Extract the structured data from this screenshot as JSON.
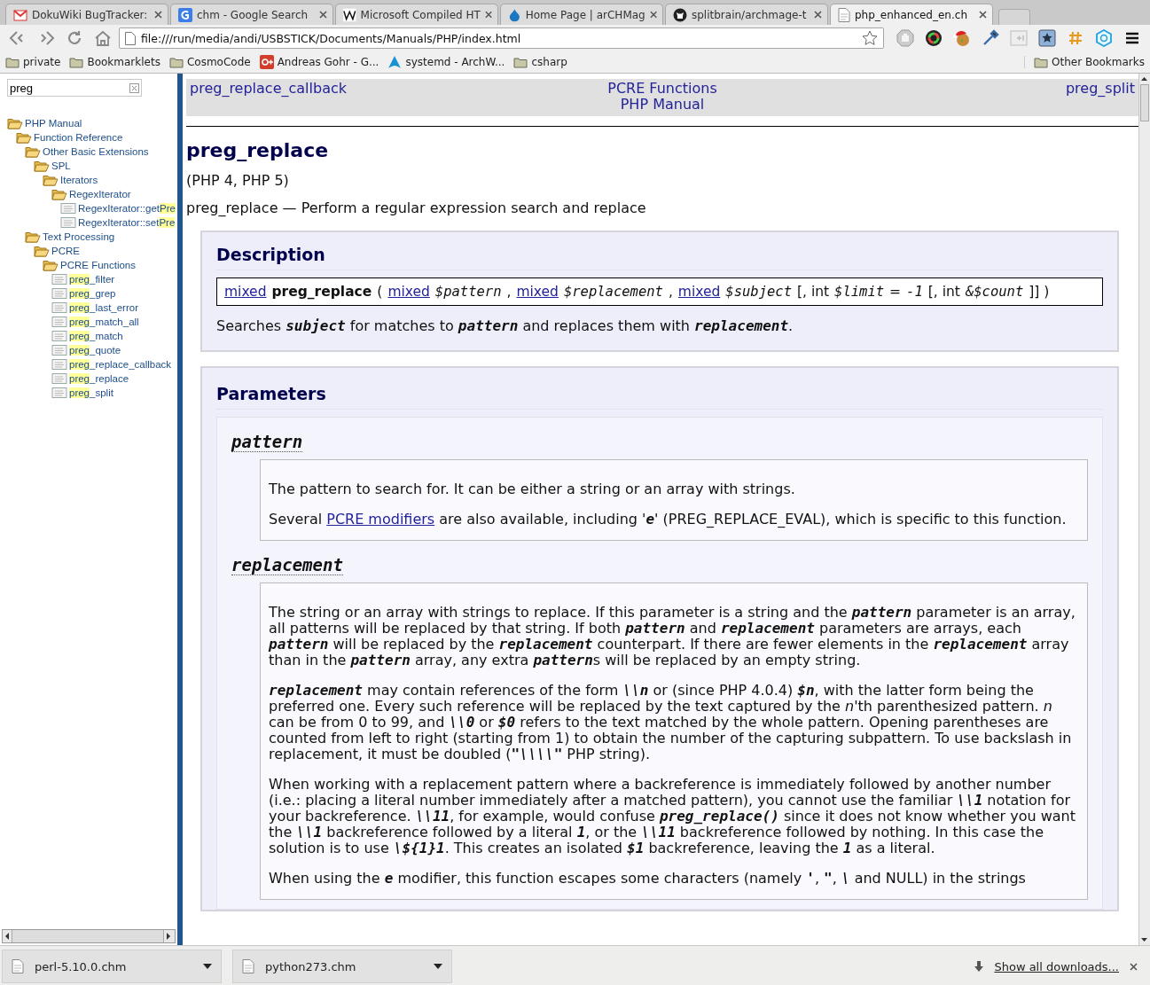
{
  "tabs": [
    {
      "title": "DokuWiki BugTracker:",
      "selected": false
    },
    {
      "title": "chm - Google Search",
      "selected": false
    },
    {
      "title": "Microsoft Compiled HT",
      "selected": false
    },
    {
      "title": "Home Page | arCHMag",
      "selected": false
    },
    {
      "title": "splitbrain/archmage-t",
      "selected": false
    },
    {
      "title": "php_enhanced_en.ch",
      "selected": true
    }
  ],
  "address_bar": {
    "value": "file:///run/media/andi/USBSTICK/Documents/Manuals/PHP/index.html"
  },
  "bookmarks": [
    {
      "label": "private",
      "kind": "folder"
    },
    {
      "label": "Bookmarklets",
      "kind": "folder"
    },
    {
      "label": "CosmoCode",
      "kind": "folder"
    },
    {
      "label": "Andreas Gohr - G...",
      "kind": "site"
    },
    {
      "label": "systemd - ArchW...",
      "kind": "site"
    },
    {
      "label": "csharp",
      "kind": "folder"
    }
  ],
  "other_bookmarks": "Other Bookmarks",
  "sidebar": {
    "search": {
      "value": "preg"
    },
    "tree": [
      {
        "kind": "folder",
        "parts": [
          {
            "text": "PHP Manual",
            "match": false
          }
        ],
        "children": [
          {
            "kind": "folder",
            "parts": [
              {
                "text": "Function Reference",
                "match": false
              }
            ],
            "children": [
              {
                "kind": "folder",
                "parts": [
                  {
                    "text": "Other Basic Extensions",
                    "match": false
                  }
                ],
                "children": [
                  {
                    "kind": "folder",
                    "parts": [
                      {
                        "text": "SPL",
                        "match": false
                      }
                    ],
                    "children": [
                      {
                        "kind": "folder",
                        "parts": [
                          {
                            "text": "Iterators",
                            "match": false
                          }
                        ],
                        "children": [
                          {
                            "kind": "folder",
                            "parts": [
                              {
                                "text": "RegexIterator",
                                "match": false
                              }
                            ],
                            "children": [
                              {
                                "kind": "page",
                                "parts": [
                                  {
                                    "text": "RegexIterator::get",
                                    "match": false
                                  },
                                  {
                                    "text": "Pre",
                                    "match": true
                                  }
                                ]
                              },
                              {
                                "kind": "page",
                                "parts": [
                                  {
                                    "text": "RegexIterator::set",
                                    "match": false
                                  },
                                  {
                                    "text": "Pre",
                                    "match": true
                                  }
                                ]
                              }
                            ]
                          }
                        ]
                      }
                    ]
                  }
                ]
              },
              {
                "kind": "folder",
                "parts": [
                  {
                    "text": "Text Processing",
                    "match": false
                  }
                ],
                "children": [
                  {
                    "kind": "folder",
                    "parts": [
                      {
                        "text": "PCRE",
                        "match": false
                      }
                    ],
                    "children": [
                      {
                        "kind": "folder",
                        "parts": [
                          {
                            "text": "PCRE Functions",
                            "match": false
                          }
                        ],
                        "children": [
                          {
                            "kind": "page",
                            "parts": [
                              {
                                "text": "preg",
                                "match": true
                              },
                              {
                                "text": "_filter",
                                "match": false
                              }
                            ]
                          },
                          {
                            "kind": "page",
                            "parts": [
                              {
                                "text": "preg",
                                "match": true
                              },
                              {
                                "text": "_grep",
                                "match": false
                              }
                            ]
                          },
                          {
                            "kind": "page",
                            "parts": [
                              {
                                "text": "preg",
                                "match": true
                              },
                              {
                                "text": "_last_error",
                                "match": false
                              }
                            ]
                          },
                          {
                            "kind": "page",
                            "parts": [
                              {
                                "text": "preg",
                                "match": true
                              },
                              {
                                "text": "_match_all",
                                "match": false
                              }
                            ]
                          },
                          {
                            "kind": "page",
                            "parts": [
                              {
                                "text": "preg",
                                "match": true
                              },
                              {
                                "text": "_match",
                                "match": false
                              }
                            ]
                          },
                          {
                            "kind": "page",
                            "parts": [
                              {
                                "text": "preg",
                                "match": true
                              },
                              {
                                "text": "_quote",
                                "match": false
                              }
                            ]
                          },
                          {
                            "kind": "page",
                            "parts": [
                              {
                                "text": "preg",
                                "match": true
                              },
                              {
                                "text": "_replace_callback",
                                "match": false
                              }
                            ]
                          },
                          {
                            "kind": "page",
                            "parts": [
                              {
                                "text": "preg",
                                "match": true
                              },
                              {
                                "text": "_replace",
                                "match": false
                              }
                            ]
                          },
                          {
                            "kind": "page",
                            "parts": [
                              {
                                "text": "preg",
                                "match": true
                              },
                              {
                                "text": "_split",
                                "match": false
                              }
                            ]
                          }
                        ]
                      }
                    ]
                  }
                ]
              }
            ]
          }
        ]
      }
    ]
  },
  "nav": {
    "prev": "preg_replace_callback",
    "up": "PCRE Functions",
    "next": "preg_split",
    "home": "PHP Manual"
  },
  "title": "preg_replace",
  "versions": "(PHP 4, PHP 5)",
  "purpose": "preg_replace — Perform a regular expression search and replace",
  "description": {
    "heading": "Description",
    "signature": [
      {
        "kind": "link",
        "text": "mixed"
      },
      {
        "kind": "name",
        "text": "preg_replace"
      },
      {
        "kind": "text",
        "text": "("
      },
      {
        "kind": "link",
        "text": "mixed"
      },
      {
        "kind": "var",
        "text": "$pattern"
      },
      {
        "kind": "text",
        "text": ","
      },
      {
        "kind": "link",
        "text": "mixed"
      },
      {
        "kind": "var",
        "text": "$replacement"
      },
      {
        "kind": "text",
        "text": ","
      },
      {
        "kind": "link",
        "text": "mixed"
      },
      {
        "kind": "var",
        "text": "$subject"
      },
      {
        "kind": "text",
        "text": "[, int"
      },
      {
        "kind": "var",
        "text": "$limit"
      },
      {
        "kind": "text",
        "text": "="
      },
      {
        "kind": "var",
        "text": "-1"
      },
      {
        "kind": "text",
        "text": "[, int"
      },
      {
        "kind": "var",
        "text": "&$count"
      },
      {
        "kind": "text",
        "text": "]] )"
      }
    ],
    "text": "Searches **subject** for matches to **pattern** and replaces them with **replacement**."
  },
  "parameters": {
    "heading": "Parameters",
    "items": [
      {
        "term": "pattern",
        "paragraphs": [
          {
            "text": "The pattern to search for. It can be either a string or an array with strings."
          },
          {
            "text": "Several ",
            "link": "PCRE modifiers",
            "after": " are also available, including '**e**' (PREG_REPLACE_EVAL), which is specific to this function."
          }
        ]
      },
      {
        "term": "replacement",
        "paragraphs": [
          {
            "text": "The string or an array with strings to replace. If this parameter is a string and the **pattern** parameter is an array, all patterns will be replaced by that string. If both **pattern** and **replacement** parameters are arrays, each **pattern** will be replaced by the **replacement** counterpart. If there are fewer elements in the **replacement** array than in the **pattern** array, any extra **pattern**s will be replaced by an empty string."
          },
          {
            "text": "**replacement** may contain references of the form **\\\\n** or (since PHP 4.0.4) **$n**, with the latter form being the preferred one. Every such reference will be replaced by the text captured by the *n*'th parenthesized pattern. *n* can be from 0 to 99, and **\\\\0** or **$0** refers to the text matched by the whole pattern. Opening parentheses are counted from left to right (starting from 1) to obtain the number of the capturing subpattern. To use backslash in replacement, it must be doubled (**\"\\\\\\\\\"** PHP string)."
          },
          {
            "text": "When working with a replacement pattern where a backreference is immediately followed by another number (i.e.: placing a literal number immediately after a matched pattern), you cannot use the familiar **\\\\1** notation for your backreference. **\\\\11**, for example, would confuse **preg_replace()** since it does not know whether you want the **\\\\1** backreference followed by a literal **1**, or the **\\\\11** backreference followed by nothing. In this case the solution is to use **\\${1}1**. This creates an isolated **$1** backreference, leaving the **1** as a literal."
          },
          {
            "text": "When using the **e** modifier, this function escapes some characters (namely **'**, **\"**, **\\** and NULL) in the strings"
          }
        ]
      }
    ]
  },
  "downloads": {
    "items": [
      {
        "name": "perl-5.10.0.chm"
      },
      {
        "name": "python273.chm"
      }
    ],
    "show_all": "Show all downloads..."
  }
}
